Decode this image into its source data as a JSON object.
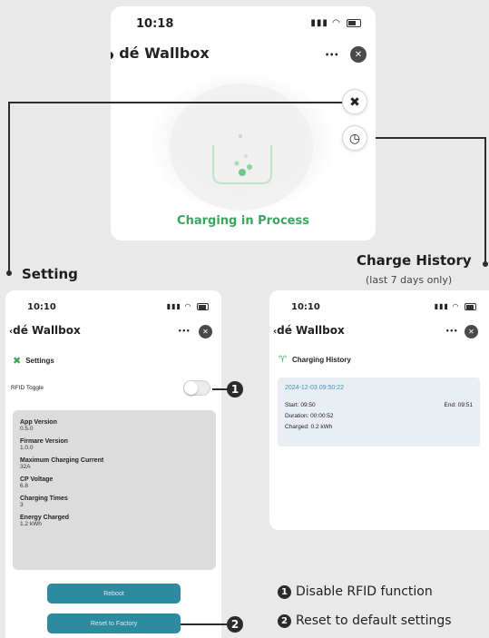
{
  "top_phone": {
    "time": "10:18",
    "app_title": "dé Wallbox",
    "more": "•••",
    "close": "✕",
    "status_text": "Charging in Process"
  },
  "setting_phone": {
    "time": "10:10",
    "app_title": "dé Wallbox",
    "back": "‹",
    "more": "•••",
    "close": "✕",
    "section_title": "Settings",
    "rfid_label": "RFID Toggle",
    "info": [
      {
        "label": "App Version",
        "value": "0.5.0"
      },
      {
        "label": "Firmare Version",
        "value": "1.0.0"
      },
      {
        "label": "Maximum Charging Current",
        "value": "32A"
      },
      {
        "label": "CP Voltage",
        "value": "6.8"
      },
      {
        "label": "Charging Times",
        "value": "3"
      },
      {
        "label": "Energy Charged",
        "value": "1.2 kWh"
      }
    ],
    "reboot_label": "Reboot",
    "reset_label": "Reset to Factory"
  },
  "history_phone": {
    "time": "10:10",
    "app_title": "dé Wallbox",
    "back": "‹",
    "more": "•••",
    "close": "✕",
    "section_title": "Charging History",
    "record": {
      "datetime": "2024-12-03 09:50:22",
      "start": "Start: 09:50",
      "end": "End: 09:51",
      "duration": "Duration: 00:00:52",
      "charged": "Charged: 0.2 kWh"
    }
  },
  "callouts": {
    "setting": "Setting",
    "history": "Charge History",
    "history_note": "(last 7 days only)",
    "num1": "1",
    "num2": "2"
  },
  "legend": [
    {
      "num": "1",
      "text": "Disable RFID function"
    },
    {
      "num": "2",
      "text": "Reset to default settings"
    }
  ],
  "colors": {
    "accent_green": "#3ba55c",
    "teal_button": "#2e8a9f",
    "date_blue": "#4a90b8"
  }
}
